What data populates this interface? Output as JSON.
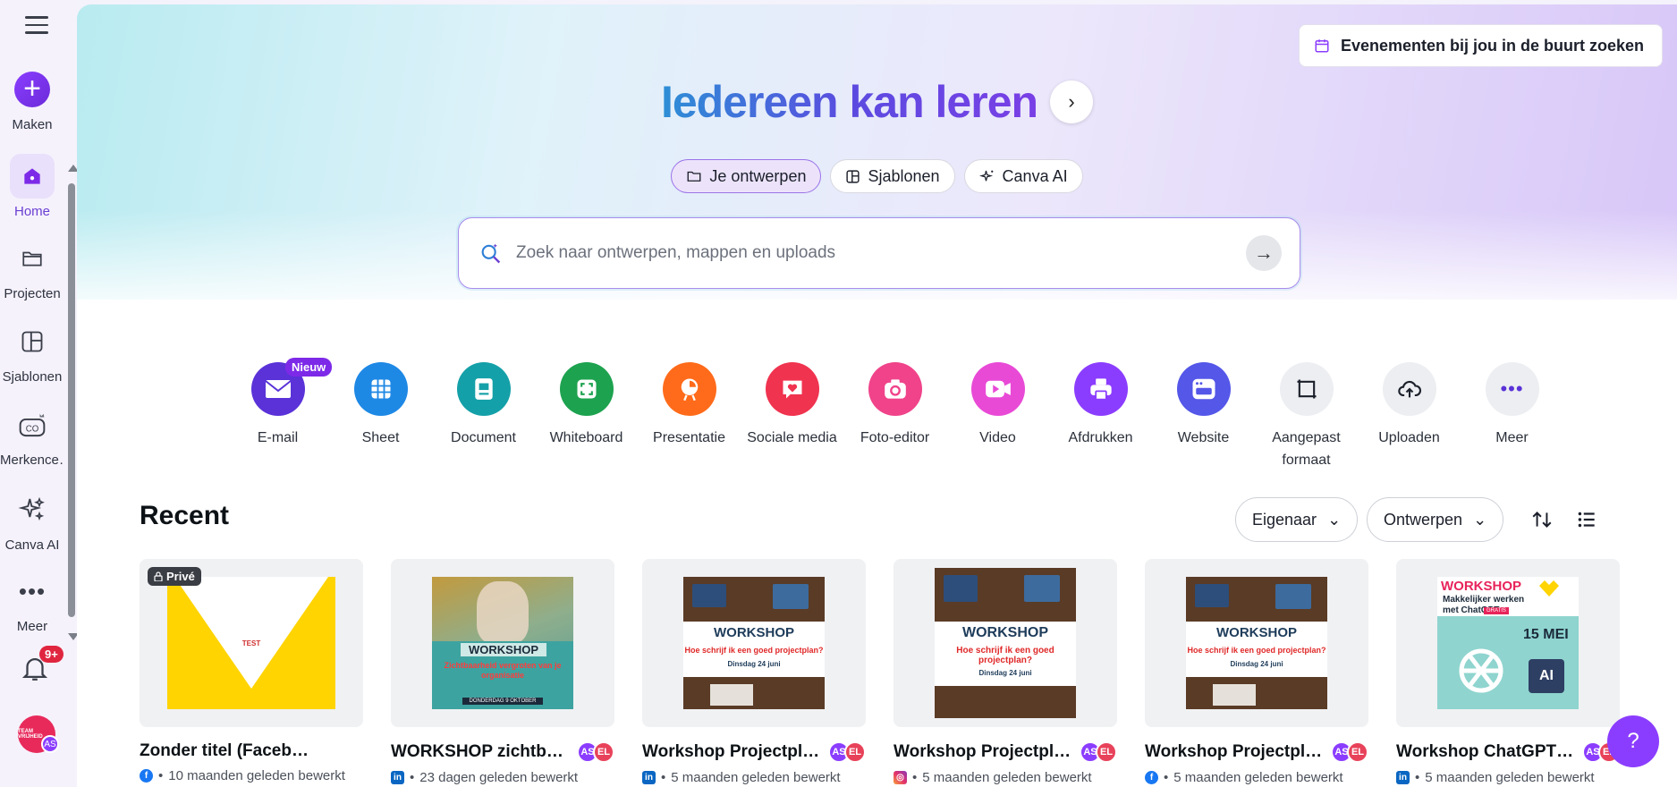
{
  "sidebar": {
    "create_label": "Maken",
    "items": [
      {
        "label": "Home",
        "icon": "home-icon"
      },
      {
        "label": "Projecten",
        "icon": "folder-icon"
      },
      {
        "label": "Sjablonen",
        "icon": "template-icon"
      },
      {
        "label": "Merkence…",
        "icon": "brand-kit-icon"
      },
      {
        "label": "Canva AI",
        "icon": "sparkle-icon"
      },
      {
        "label": "Meer",
        "icon": "more-icon"
      }
    ],
    "notification_badge": "9+",
    "avatar_initials": "AS",
    "avatar_text": "TEAM VRIJHEID"
  },
  "header": {
    "events_button": "Evenementen bij jou in de buurt zoeken",
    "title": "Iedereen kan leren",
    "tabs": [
      {
        "label": "Je ontwerpen",
        "active": true
      },
      {
        "label": "Sjablonen",
        "active": false
      },
      {
        "label": "Canva AI",
        "active": false
      }
    ],
    "search_placeholder": "Zoek naar ontwerpen, mappen en uploads"
  },
  "shortcuts": [
    {
      "label": "E-mail",
      "color": "#5a32d8",
      "badge": "Nieuw"
    },
    {
      "label": "Sheet",
      "color": "#1e88e5"
    },
    {
      "label": "Document",
      "color": "#14a0a8"
    },
    {
      "label": "Whiteboard",
      "color": "#1da24f"
    },
    {
      "label": "Presentatie",
      "color": "#ff6b1a"
    },
    {
      "label": "Sociale media",
      "color": "#f0334f"
    },
    {
      "label": "Foto-editor",
      "color": "#f0438a"
    },
    {
      "label": "Video",
      "color": "#e84ad6"
    },
    {
      "label": "Afdrukken",
      "color": "#8b3dff"
    },
    {
      "label": "Website",
      "color": "#5457e8"
    },
    {
      "label": "Aangepast formaat",
      "color": "#eceef1"
    },
    {
      "label": "Uploaden",
      "color": "#eceef1"
    },
    {
      "label": "Meer",
      "color": "#eceef1"
    }
  ],
  "recent": {
    "title": "Recent",
    "owner_filter": "Eigenaar",
    "type_filter": "Ontwerpen",
    "cards": [
      {
        "title": "Zonder titel (Facebook-be…",
        "meta": "10 maanden geleden bewerkt",
        "platform": "facebook",
        "private": "Privé",
        "thumb_text": "TEST",
        "collab": false
      },
      {
        "title": "WORKSHOP zichtba…",
        "meta": "23 dagen geleden bewerkt",
        "platform": "linkedin",
        "thumb_text": "WORKSHOP",
        "thumb_sub": "Zichtbaarheid vergroten van je organisatie",
        "thumb_date": "DONDERDAG 9 OKTOBER",
        "collab": true
      },
      {
        "title": "Workshop Projectpla…",
        "meta": "5 maanden geleden bewerkt",
        "platform": "linkedin",
        "thumb_text": "WORKSHOP",
        "thumb_sub": "Hoe schrijf ik een goed projectplan?",
        "thumb_date": "Dinsdag 24 juni",
        "collab": true
      },
      {
        "title": "Workshop Projectpla…",
        "meta": "5 maanden geleden bewerkt",
        "platform": "instagram",
        "thumb_text": "WORKSHOP",
        "thumb_sub": "Hoe schrijf ik een goed projectplan?",
        "thumb_date": "Dinsdag 24 juni",
        "collab": true
      },
      {
        "title": "Workshop Projectpla…",
        "meta": "5 maanden geleden bewerkt",
        "platform": "facebook",
        "thumb_text": "WORKSHOP",
        "thumb_sub": "Hoe schrijf ik een goed projectplan?",
        "thumb_date": "Dinsdag 24 juni",
        "collab": true
      },
      {
        "title": "Workshop ChatGPT -…",
        "meta": "5 maanden geleden bewerkt",
        "platform": "linkedin",
        "thumb_text": "WORKSHOP",
        "thumb_sub": "Makkelijker werken met ChatGPT",
        "thumb_date": "15 MEI",
        "collab": true
      }
    ],
    "collab_initials": [
      "AS",
      "EL"
    ],
    "gratis": "GRATIS",
    "ai_label": "AI"
  },
  "help_label": "?"
}
